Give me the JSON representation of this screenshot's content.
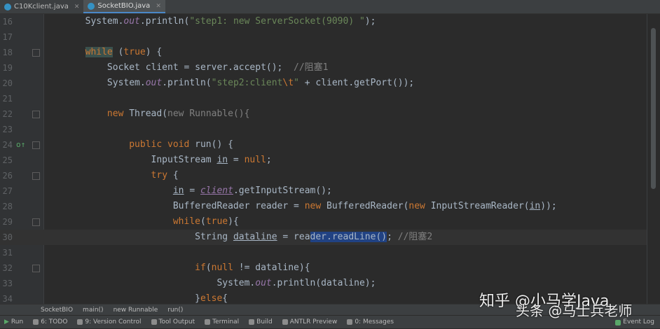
{
  "tabs": [
    {
      "label": "C10Kclient.java",
      "active": false
    },
    {
      "label": "SocketBIO.java",
      "active": true
    }
  ],
  "lines": [
    {
      "n": "16",
      "html": "        System.<span class='it'>out</span>.println(<span class='str'>\"step1: new ServerSocket(9090) \"</span>);"
    },
    {
      "n": "17",
      "html": ""
    },
    {
      "n": "18",
      "html": "        <span class='kw hl-while'>while</span> (<span class='kw'>true</span>) {"
    },
    {
      "n": "19",
      "html": "            Socket client = server.accept();  <span class='cm'>//阻塞1</span>"
    },
    {
      "n": "20",
      "html": "            System.<span class='it'>out</span>.println(<span class='str'>\"step2:client<span class='kw'>\\t</span>\"</span> + client.getPort());"
    },
    {
      "n": "21",
      "html": ""
    },
    {
      "n": "22",
      "html": "            <span class='kw'>new</span> Thread(<span class='gray'>new Runnable(){</span>"
    },
    {
      "n": "23",
      "html": ""
    },
    {
      "n": "24",
      "html": "                <span class='kw'>public void</span> run() {"
    },
    {
      "n": "25",
      "html": "                    InputStream <span class='fld'>in</span> = <span class='kw'>null</span>;"
    },
    {
      "n": "26",
      "html": "                    <span class='kw'>try</span> {"
    },
    {
      "n": "27",
      "html": "                        <span class='fld'>in</span> = <span class='it' style='text-decoration:underline'>client</span>.getInputStream();"
    },
    {
      "n": "28",
      "html": "                        BufferedReader reader = <span class='kw'>new</span> BufferedReader(<span class='kw'>new</span> InputStreamReader(<span class='fld'>in</span>));"
    },
    {
      "n": "29",
      "html": "                        <span class='kw'>while</span>(<span class='kw'>true</span>){"
    },
    {
      "n": "30",
      "html": "                            String <span class='fld'>dataline</span> = rea<span class='sel'>der.readLine()</span>; <span class='cm'>//阻塞2</span>"
    },
    {
      "n": "31",
      "html": ""
    },
    {
      "n": "32",
      "html": "                            <span class='kw'>if</span>(<span class='kw'>null</span> != dataline){"
    },
    {
      "n": "33",
      "html": "                                System.<span class='it'>out</span>.println(dataline);"
    },
    {
      "n": "34",
      "html": "                            }<span class='kw'>else</span>{"
    }
  ],
  "breadcrumb": [
    "SocketBIO",
    "main()",
    "new Runnable",
    "run()"
  ],
  "toolbar": [
    {
      "label": "Run"
    },
    {
      "label": "6: TODO"
    },
    {
      "label": "9: Version Control"
    },
    {
      "label": "Tool Output"
    },
    {
      "label": "Terminal"
    },
    {
      "label": "Build"
    },
    {
      "label": "ANTLR Preview"
    },
    {
      "label": "0: Messages"
    }
  ],
  "event_log": "Event Log",
  "watermark": {
    "line1": "知乎 @小马学Java",
    "line2": "头条 @马士兵老师"
  }
}
